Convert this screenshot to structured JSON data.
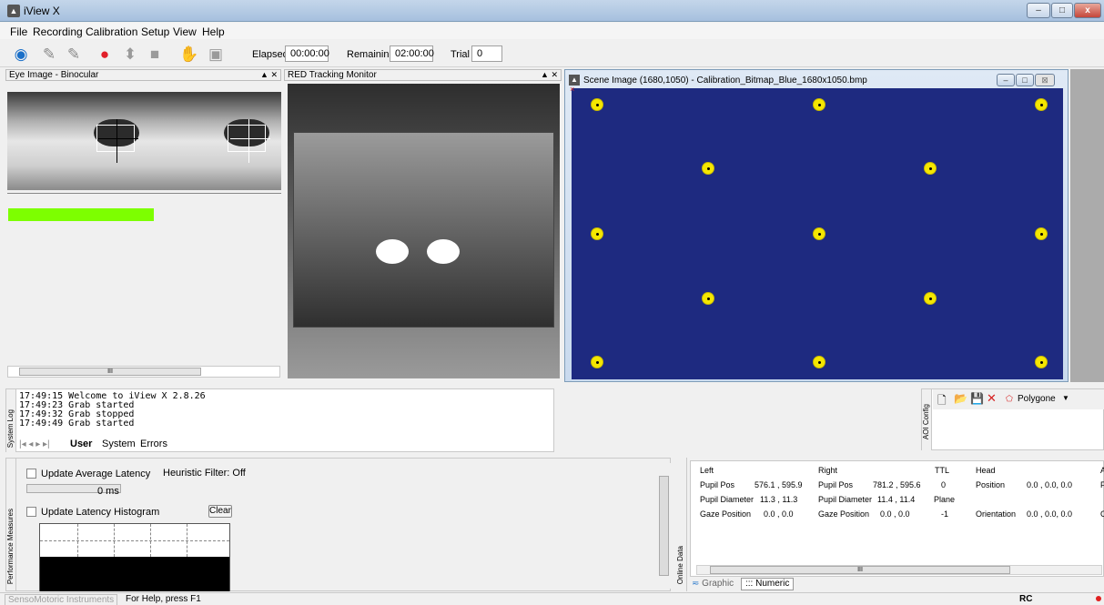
{
  "window": {
    "title": "iView X",
    "minimize": "–",
    "maximize": "□",
    "close": "x"
  },
  "menu": [
    "File",
    "Recording",
    "Calibration",
    "Setup",
    "View",
    "Help"
  ],
  "toolbar": {
    "elapsed_label": "Elapsed",
    "elapsed_value": "00:00:00",
    "remaining_label": "Remaining",
    "remaining_value": "02:00:00",
    "trial_label": "Trial",
    "trial_value": "0"
  },
  "eye_panel": {
    "title": "Eye Image - Binocular",
    "close": "▲ ✕",
    "scroll_thumb": "III"
  },
  "red_panel": {
    "title": "RED Tracking Monitor",
    "close": "▲ ✕"
  },
  "scene": {
    "title": "Scene Image (1680,1050) - Calibration_Bitmap_Blue_1680x1050.bmp",
    "background_color": "#1e2a80",
    "dot_color": "#f5e700",
    "grid_rows": 5,
    "corner_mark": "×"
  },
  "system_log": {
    "side_label": "System Log",
    "lines": [
      "17:49:15  Welcome to iView X 2.8.26",
      "17:49:23  Grab started",
      "17:49:32  Grab stopped",
      "17:49:49  Grab started"
    ],
    "tabs": [
      "User",
      "System",
      "Errors"
    ],
    "nav": "|◂ ◂ ▸ ▸|"
  },
  "aoi": {
    "side_label": "AOI Config",
    "tool": "Polygone",
    "new_icon": "🗋",
    "open_icon": "📂",
    "save_icon": "💾",
    "delete_icon": "✕"
  },
  "perf": {
    "side_label": "Performance Measures",
    "update_avg_latency": "Update Average Latency",
    "heuristic_filter": "Heuristic Filter: Off",
    "latency_value": "0 ms",
    "update_histogram": "Update Latency Histogram",
    "clear": "Clear"
  },
  "online": {
    "side_label": "Online Data",
    "left_header": "Left",
    "right_header": "Right",
    "ttl_header": "TTL",
    "head_header": "Head",
    "a_header": "A",
    "left_pupil_pos_label": "Pupil Pos",
    "left_pupil_pos": "576.1 , 595.9",
    "left_pupil_diam_label": "Pupil Diameter",
    "left_pupil_diam": "11.3 , 11.3",
    "left_gaze_label": "Gaze Position",
    "left_gaze": "0.0 , 0.0",
    "right_pupil_pos_label": "Pupil Pos",
    "right_pupil_pos": "781.2 , 595.6",
    "right_pupil_diam_label": "Pupil Diameter",
    "right_pupil_diam": "11.4 , 11.4",
    "right_gaze_label": "Gaze Position",
    "right_gaze": "0.0 , 0.0",
    "ttl_value": "0",
    "plane_label": "Plane",
    "plane_value": "-1",
    "position_label": "Position",
    "position_value": "0.0 , 0.0, 0.0",
    "orientation_label": "Orientation",
    "orientation_value": "0.0 , 0.0, 0.0",
    "trunc_f": "F",
    "trunc_c": "C",
    "tab_graphic": "Graphic",
    "tab_numeric": "Numeric",
    "scroll_thumb": "III"
  },
  "status": {
    "company": "SensoMotoric Instruments",
    "help": "For Help, press F1",
    "rc": "RC"
  }
}
